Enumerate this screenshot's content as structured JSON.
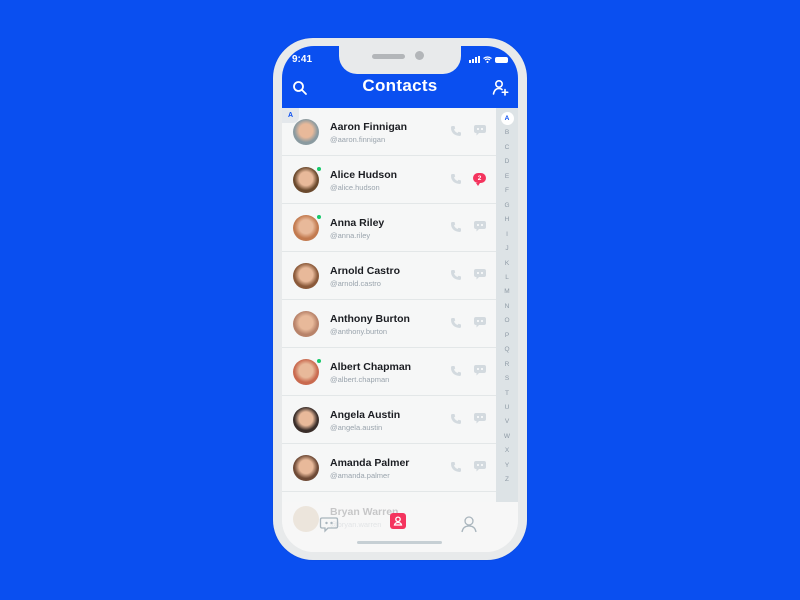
{
  "status_bar": {
    "time": "9:41"
  },
  "header": {
    "title": "Contacts",
    "search_icon": "search-icon",
    "add_contact_icon": "add-user-icon"
  },
  "section": {
    "current_letter": "A"
  },
  "contacts": [
    {
      "name": "Aaron Finnigan",
      "handle": "@aaron.finnigan",
      "online": false,
      "unread": null,
      "avatar_color": "#8a9aa0"
    },
    {
      "name": "Alice Hudson",
      "handle": "@alice.hudson",
      "online": true,
      "unread": "2",
      "avatar_color": "#6b4a2e"
    },
    {
      "name": "Anna Riley",
      "handle": "@anna.riley",
      "online": true,
      "unread": null,
      "avatar_color": "#c27a4f"
    },
    {
      "name": "Arnold Castro",
      "handle": "@arnold.castro",
      "online": false,
      "unread": null,
      "avatar_color": "#8b5a3a"
    },
    {
      "name": "Anthony Burton",
      "handle": "@anthony.burton",
      "online": false,
      "unread": null,
      "avatar_color": "#b8836a"
    },
    {
      "name": "Albert Chapman",
      "handle": "@albert.chapman",
      "online": true,
      "unread": null,
      "avatar_color": "#c96a4f"
    },
    {
      "name": "Angela Austin",
      "handle": "@angela.austin",
      "online": false,
      "unread": null,
      "avatar_color": "#3a2e2a"
    },
    {
      "name": "Amanda Palmer",
      "handle": "@amanda.palmer",
      "online": false,
      "unread": null,
      "avatar_color": "#6e4a36"
    }
  ],
  "ghost_contact": {
    "name": "Bryan Warren",
    "handle": "@bryan.warren"
  },
  "index_letters": [
    "A",
    "B",
    "C",
    "D",
    "E",
    "F",
    "G",
    "H",
    "I",
    "J",
    "K",
    "L",
    "M",
    "N",
    "O",
    "P",
    "Q",
    "R",
    "S",
    "T",
    "U",
    "V",
    "W",
    "X",
    "Y",
    "Z"
  ],
  "index_active": "A",
  "tabs": [
    {
      "name": "messages",
      "icon": "chat-bubble-icon",
      "active": false
    },
    {
      "name": "contacts",
      "icon": "contact-card-icon",
      "active": true
    },
    {
      "name": "profile",
      "icon": "user-icon",
      "active": false
    }
  ],
  "colors": {
    "brand": "#0a4ff0",
    "accent": "#f4345e",
    "online": "#17c96b"
  }
}
